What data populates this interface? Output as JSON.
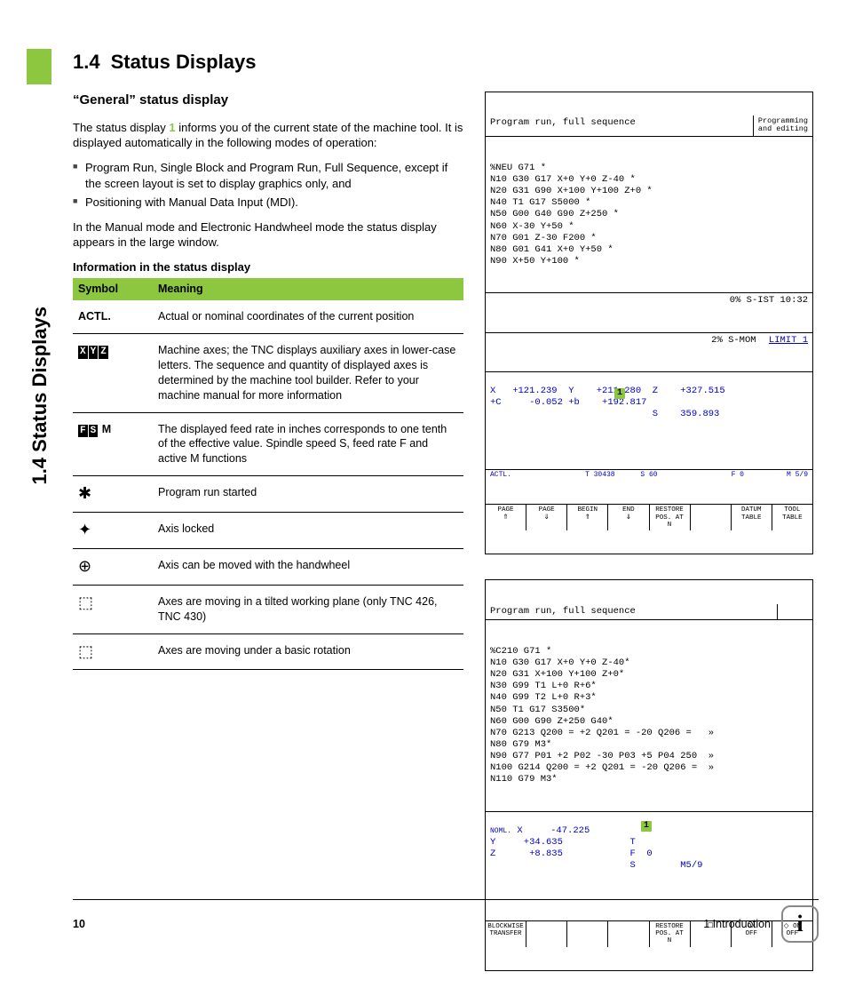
{
  "sideTab": "1.4 Status Displays",
  "heading": {
    "num": "1.4",
    "title": "Status Displays"
  },
  "subheading": "“General” status display",
  "intro1a": "The status display ",
  "intro1hl": "1",
  "intro1b": " informs you of the current state of the machine tool. It is displayed automatically in the following modes of operation:",
  "bullets": [
    "Program Run, Single Block and Program Run, Full Sequence, except if the screen layout is set to display graphics only, and",
    "Positioning with Manual Data Input (MDI)."
  ],
  "intro2": "In the Manual mode and Electronic Handwheel mode the status display appears in the large window.",
  "infoHeader": "Information in the status display",
  "tableHead": {
    "c1": "Symbol",
    "c2": "Meaning"
  },
  "rows": [
    {
      "symHtml": "ACTL.",
      "meaning": "Actual or nominal coordinates of the current position"
    },
    {
      "symHtml": "XYZ",
      "meaning": "Machine axes; the TNC displays auxiliary axes in lower-case letters. The sequence and quantity of displayed axes is determined by the machine tool builder. Refer to your machine manual for more information"
    },
    {
      "symHtml": "FSM",
      "meaning": "The displayed feed rate in inches corresponds to one tenth of the effective value. Spindle speed S, feed rate F and active M functions"
    },
    {
      "symHtml": "star",
      "meaning": "Program run started"
    },
    {
      "symHtml": "lock",
      "meaning": "Axis locked"
    },
    {
      "symHtml": "wheel",
      "meaning": "Axis can be moved with the handwheel"
    },
    {
      "symHtml": "tilt",
      "meaning": "Axes are moving in a tilted working plane (only TNC 426, TNC 430)"
    },
    {
      "symHtml": "rot",
      "meaning": "Axes are moving under a basic rotation"
    }
  ],
  "screen1": {
    "title": "Program run, full sequence",
    "side": "Programming\nand editing",
    "code": "%NEU G71 *\nN10 G30 G17 X+0 Y+0 Z-40 *\nN20 G31 G90 X+100 Y+100 Z+0 *\nN40 T1 G17 S5000 *\nN50 G00 G40 G90 Z+250 *\nN60 X-30 Y+50 *\nN70 G01 Z-30 F200 *\nN80 G01 G41 X+0 Y+50 *\nN90 X+50 Y+100 *",
    "status1": "0% S-IST 10:32",
    "status2a": "2% S-MOM ",
    "status2b": "LIMIT 1",
    "pos": "X   +121.239  Y    +211.280  Z    +327.515\n+C     -0.052 +b    +192.817\n                             S    359.893",
    "posSmallL": "ACTL.",
    "posSmallM": "T 30438      S 60",
    "posSmallR": "F 0          M 5/9",
    "sk": [
      "PAGE\n⇑",
      "PAGE\n⇓",
      "BEGIN\n⇑",
      "END\n⇓",
      "RESTORE\nPOS. AT\nN",
      " ",
      "DATUM\nTABLE",
      "TOOL\nTABLE"
    ]
  },
  "screen2": {
    "title": "Program run, full sequence",
    "code": "%C210 G71 *\nN10 G30 G17 X+0 Y+0 Z-40*\nN20 G31 X+100 Y+100 Z+0*\nN30 G99 T1 L+0 R+6*\nN40 G99 T2 L+0 R+3*\nN50 T1 G17 S3500*\nN60 G00 G90 Z+250 G40*\nN70 G213 Q200 = +2 Q201 = -20 Q206 =   »\nN80 G79 M3*\nN90 G77 P01 +2 P02 -30 P03 +5 P04 250  »\nN100 G214 Q200 = +2 Q201 = -20 Q206 =  »\nN110 G79 M3*",
    "posLabel": "NOML.",
    "pos": "X     -47.225\nY     +34.635            T\nZ      +8.835            F  0\n                         S        M5/9",
    "sk": [
      "BLOCKWISE\nTRANSFER",
      " ",
      " ",
      " ",
      "RESTORE\nPOS. AT\nN",
      "☐",
      "ON\nOFF",
      "◇ ON\nOFF"
    ]
  },
  "footer": {
    "page": "10",
    "chapter": "1 Introduction"
  }
}
